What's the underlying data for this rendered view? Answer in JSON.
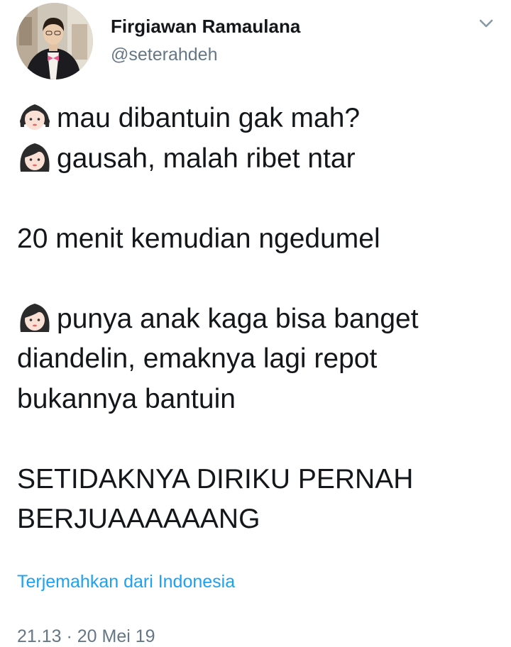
{
  "author": {
    "display_name": "Firgiawan Ramaulana",
    "handle": "@seterahdeh",
    "avatar_icon": "profile-photo"
  },
  "menu_icon": "chevron-down-icon",
  "tweet": {
    "lines": [
      {
        "emoji": "girl-emoji",
        "text": "mau dibantuin gak mah?"
      },
      {
        "emoji": "woman-emoji",
        "text": "gausah, malah ribet ntar"
      },
      {
        "text": "20 menit kemudian ngedumel"
      },
      {
        "emoji": "woman-emoji",
        "text": "punya anak kaga bisa banget"
      },
      {
        "text": "diandelin, emaknya lagi repot"
      },
      {
        "text": "bukannya bantuin"
      },
      {
        "text": "SETIDAKNYA DIRIKU PERNAH"
      },
      {
        "text": "BERJUAAAAAANG"
      }
    ]
  },
  "translate_link": "Terjemahkan dari Indonesia",
  "timestamp": "21.13 · 20 Mei 19",
  "colors": {
    "text": "#14171a",
    "secondary": "#657786",
    "link": "#1da1f2"
  }
}
